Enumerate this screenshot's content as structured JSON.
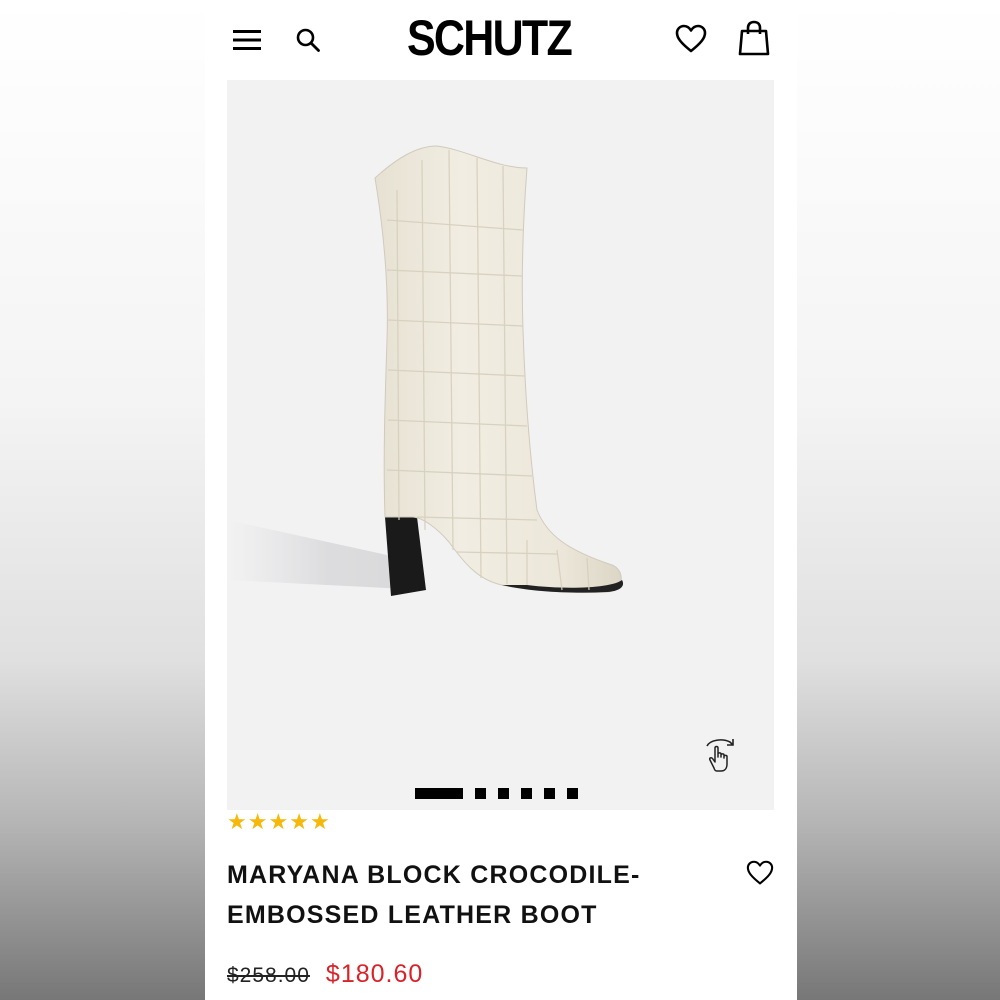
{
  "header": {
    "brand": "SCHUTZ",
    "menu_icon": "hamburger-menu-icon",
    "search_icon": "search-icon",
    "wishlist_icon": "heart-icon",
    "bag_icon": "shopping-bag-icon"
  },
  "gallery": {
    "image": "cream crocodile-embossed knee-high boot with black block heel",
    "swipe_icon": "swipe-gesture-icon",
    "total_images": 6,
    "active_index": 0
  },
  "product": {
    "rating_stars": 5,
    "title": "MARYANA BLOCK CROCODILE-EMBOSSED LEATHER BOOT",
    "old_price": "$258.00",
    "new_price": "$180.60",
    "favorite_icon": "heart-outline-icon"
  },
  "colors": {
    "accent_sale": "#d8232a",
    "star": "#f5b80b",
    "gallery_bg": "#f2f2f3"
  }
}
